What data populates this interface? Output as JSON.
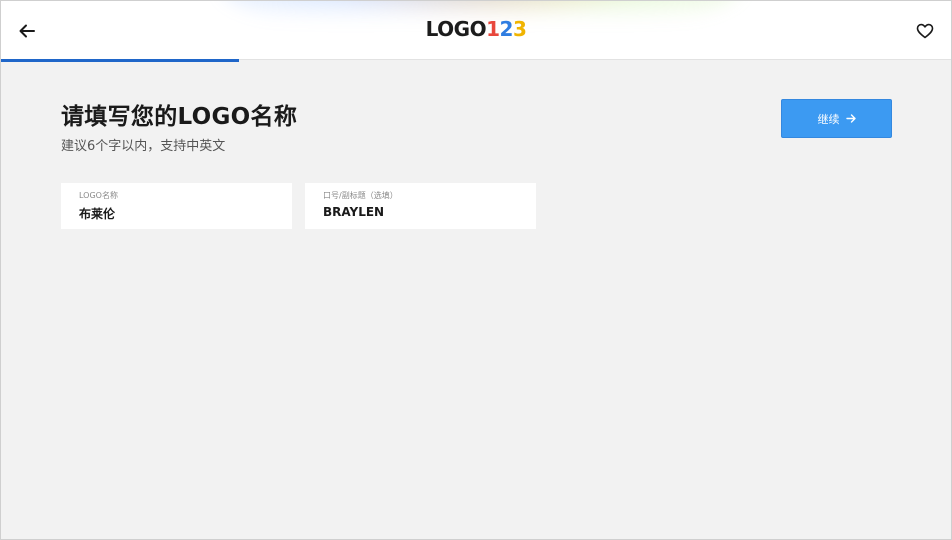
{
  "header": {
    "logo_text": "LOGO",
    "logo_digit_1": "1",
    "logo_digit_2": "2",
    "logo_digit_3": "3",
    "back_icon": "arrow-left-icon",
    "favorite_icon": "heart-icon"
  },
  "progress": {
    "fraction": 0.25,
    "color": "#1f66c9"
  },
  "main": {
    "title": "请填写您的LOGO名称",
    "subtitle": "建议6个字以内，支持中英文",
    "continue_label": "继续",
    "continue_icon": "arrow-right-icon"
  },
  "fields": {
    "logo_name": {
      "label": "LOGO名称",
      "value": "布莱伦"
    },
    "slogan": {
      "label": "口号/副标题（选填）",
      "value": "BRAYLEN"
    }
  },
  "colors": {
    "accent": "#3c9af2",
    "background": "#f2f2f2"
  }
}
